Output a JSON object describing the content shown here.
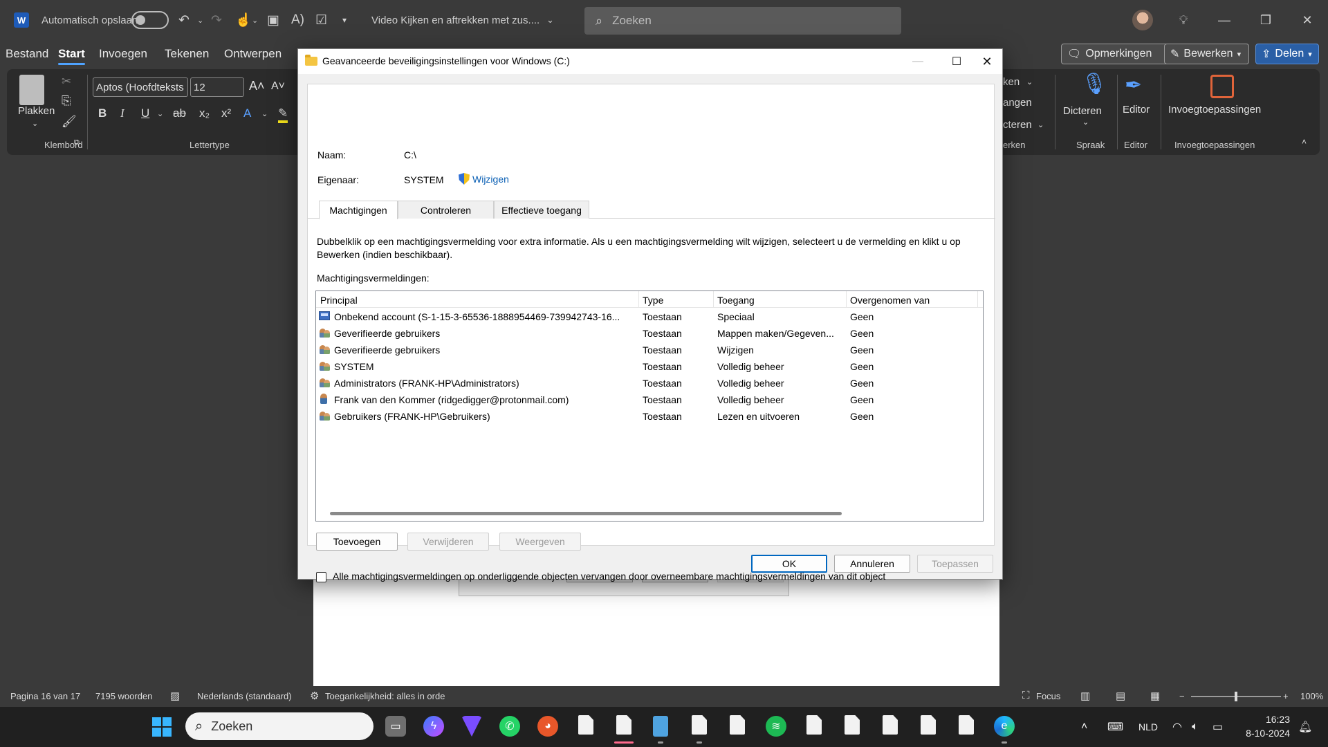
{
  "app": {
    "autosave_label": "Automatisch opslaan",
    "doc_title": "Video Kijken en aftrekken met zus....",
    "search_placeholder": "Zoeken"
  },
  "menu": {
    "items": [
      "Bestand",
      "Start",
      "Invoegen",
      "Tekenen",
      "Ontwerpen"
    ],
    "active": "Start",
    "opmerkingen": "Opmerkingen",
    "bewerken": "Bewerken",
    "delen": "Delen"
  },
  "ribbon": {
    "plakken": "Plakken",
    "klembord": "Klembord",
    "font_name": "Aptos (Hoofdteksts",
    "font_size": "12",
    "lettertype": "Lettertype",
    "partial_1": "ken",
    "partial_2": "angen",
    "partial_3": "cteren",
    "partial_4": "erken",
    "dicteren": "Dicteren",
    "spraak": "Spraak",
    "editor": "Editor",
    "editor_group": "Editor",
    "invoeg": "Invoegtoepassingen",
    "invoeg_group": "Invoegtoepassingen"
  },
  "behind_dialog": {
    "ok": "OK",
    "cancel": "Annuleren",
    "apply": "Toepassen"
  },
  "dialog": {
    "title": "Geavanceerde beveiligingsinstellingen voor Windows (C:)",
    "naam_label": "Naam:",
    "naam_value": "C:\\",
    "eigenaar_label": "Eigenaar:",
    "eigenaar_value": "SYSTEM",
    "wijzigen": "Wijzigen",
    "tabs": [
      "Machtigingen",
      "Controleren",
      "Effectieve toegang"
    ],
    "description": "Dubbelklik op een machtigingsvermelding voor extra informatie. Als u een machtigingsvermelding wilt wijzigen, selecteert u de vermelding en klikt u op Bewerken (indien beschikbaar).",
    "entries_label": "Machtigingsvermeldingen:",
    "columns": [
      "Principal",
      "Type",
      "Toegang",
      "Overgenomen van"
    ],
    "rows": [
      {
        "icon": "unknown-account-icon",
        "principal": "Onbekend account (S-1-15-3-65536-1888954469-739942743-16...",
        "type": "Toestaan",
        "access": "Speciaal",
        "inherited": "Geen"
      },
      {
        "icon": "users-icon",
        "principal": "Geverifieerde gebruikers",
        "type": "Toestaan",
        "access": "Mappen maken/Gegeven...",
        "inherited": "Geen"
      },
      {
        "icon": "users-icon",
        "principal": "Geverifieerde gebruikers",
        "type": "Toestaan",
        "access": "Wijzigen",
        "inherited": "Geen"
      },
      {
        "icon": "users-icon",
        "principal": "SYSTEM",
        "type": "Toestaan",
        "access": "Volledig beheer",
        "inherited": "Geen"
      },
      {
        "icon": "users-icon",
        "principal": "Administrators (FRANK-HP\\Administrators)",
        "type": "Toestaan",
        "access": "Volledig beheer",
        "inherited": "Geen"
      },
      {
        "icon": "user-icon",
        "principal": "Frank van den Kommer (ridgedigger@protonmail.com)",
        "type": "Toestaan",
        "access": "Volledig beheer",
        "inherited": "Geen"
      },
      {
        "icon": "users-icon",
        "principal": "Gebruikers (FRANK-HP\\Gebruikers)",
        "type": "Toestaan",
        "access": "Lezen en uitvoeren",
        "inherited": "Geen"
      }
    ],
    "add": "Toevoegen",
    "remove": "Verwijderen",
    "view": "Weergeven",
    "replace_checkbox": "Alle machtigingsvermeldingen op onderliggende objecten vervangen door overneembare machtigingsvermeldingen van dit object",
    "ok": "OK",
    "cancel": "Annuleren",
    "apply": "Toepassen"
  },
  "status": {
    "page": "Pagina 16 van 17",
    "words": "7195 woorden",
    "language": "Nederlands (standaard)",
    "accessibility": "Toegankelijkheid: alles in orde",
    "focus": "Focus",
    "zoom": "100%",
    "zoom_level": 0.5
  },
  "taskbar": {
    "search": "Zoeken",
    "language": "NLD",
    "time": "16:23",
    "date": "8-10-2024"
  },
  "colors": {
    "accent": "#0067c0",
    "link": "#0a5fb4",
    "titlebar": "#3a3a3a",
    "ribbon": "#2b2b2b"
  }
}
